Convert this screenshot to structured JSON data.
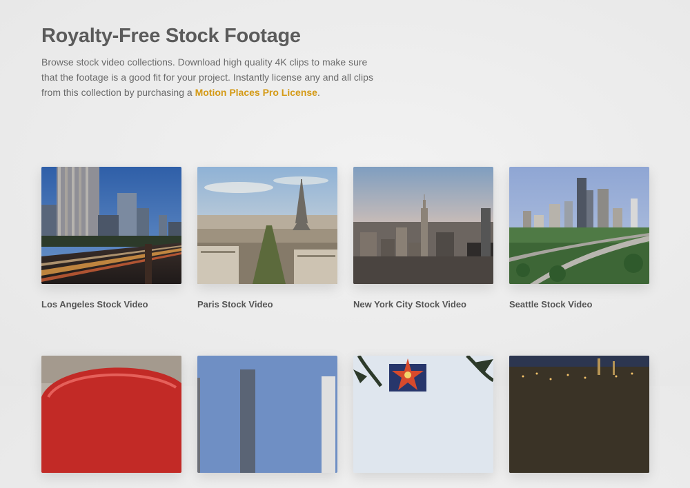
{
  "hero": {
    "title": "Royalty-Free Stock Footage",
    "description": "Browse stock video collections. Download high quality 4K clips to make sure that the footage is a good fit for your project. Instantly license any and all clips from this collection by purchasing a ",
    "link_text": "Motion Places Pro License",
    "description_end": "."
  },
  "collections": [
    {
      "title": "Los Angeles Stock Video",
      "image": "los-angeles-skyline-freeway"
    },
    {
      "title": "Paris Stock Video",
      "image": "paris-eiffel-tower"
    },
    {
      "title": "New York City Stock Video",
      "image": "new-york-empire-state"
    },
    {
      "title": "Seattle Stock Video",
      "image": "seattle-skyline-freeway"
    },
    {
      "title": "",
      "image": "red-arch-structure"
    },
    {
      "title": "",
      "image": "city-skyline-blue-sky"
    },
    {
      "title": "",
      "image": "palm-trees-star-sign"
    },
    {
      "title": "",
      "image": "city-lights-night-aerial"
    }
  ],
  "colors": {
    "accent": "#d49a16",
    "heading": "#5b5b5b",
    "text": "#6a6a6a",
    "background": "#ececec"
  }
}
